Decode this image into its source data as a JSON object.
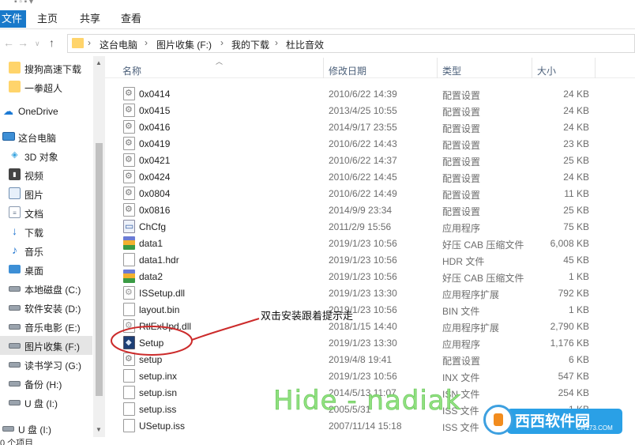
{
  "ribbon": {
    "file_tab": "文件",
    "home_tab": "主页",
    "share_tab": "共享",
    "view_tab": "查看"
  },
  "address": {
    "crumbs": [
      "这台电脑",
      "图片收集 (F:)",
      "我的下载",
      "杜比音效"
    ],
    "separator": "›"
  },
  "nav_pane": {
    "items": [
      {
        "label": "搜狗高速下载",
        "icon": "folder-icon"
      },
      {
        "label": "一拳超人",
        "icon": "folder-icon"
      },
      {
        "label": "OneDrive",
        "icon": "cloud-icon"
      },
      {
        "label": "这台电脑",
        "icon": "computer-icon"
      },
      {
        "label": "3D 对象",
        "icon": "3d-objects-icon"
      },
      {
        "label": "视频",
        "icon": "video-icon"
      },
      {
        "label": "图片",
        "icon": "pictures-icon"
      },
      {
        "label": "文档",
        "icon": "documents-icon"
      },
      {
        "label": "下载",
        "icon": "download-icon"
      },
      {
        "label": "音乐",
        "icon": "music-icon"
      },
      {
        "label": "桌面",
        "icon": "desktop-icon"
      },
      {
        "label": "本地磁盘 (C:)",
        "icon": "drive-icon"
      },
      {
        "label": "软件安装 (D:)",
        "icon": "drive-icon"
      },
      {
        "label": "音乐电影 (E:)",
        "icon": "drive-icon"
      },
      {
        "label": "图片收集 (F:)",
        "icon": "drive-icon"
      },
      {
        "label": "读书学习 (G:)",
        "icon": "drive-icon"
      },
      {
        "label": "备份 (H:)",
        "icon": "drive-icon"
      },
      {
        "label": "U 盘 (I:)",
        "icon": "drive-icon"
      },
      {
        "label": "U 盘 (I:)",
        "icon": "drive-icon"
      }
    ],
    "status": "0 个项目"
  },
  "file_list": {
    "columns": {
      "name": "名称",
      "date": "修改日期",
      "type": "类型",
      "size": "大小"
    },
    "rows": [
      {
        "name": "0x0414",
        "date": "2010/6/22 14:39",
        "type": "配置设置",
        "size": "24 KB",
        "icon": "config-file-icon"
      },
      {
        "name": "0x0415",
        "date": "2013/4/25 10:55",
        "type": "配置设置",
        "size": "24 KB",
        "icon": "config-file-icon"
      },
      {
        "name": "0x0416",
        "date": "2014/9/17 23:55",
        "type": "配置设置",
        "size": "24 KB",
        "icon": "config-file-icon"
      },
      {
        "name": "0x0419",
        "date": "2010/6/22 14:43",
        "type": "配置设置",
        "size": "23 KB",
        "icon": "config-file-icon"
      },
      {
        "name": "0x0421",
        "date": "2010/6/22 14:37",
        "type": "配置设置",
        "size": "25 KB",
        "icon": "config-file-icon"
      },
      {
        "name": "0x0424",
        "date": "2010/6/22 14:45",
        "type": "配置设置",
        "size": "24 KB",
        "icon": "config-file-icon"
      },
      {
        "name": "0x0804",
        "date": "2010/6/22 14:49",
        "type": "配置设置",
        "size": "11 KB",
        "icon": "config-file-icon"
      },
      {
        "name": "0x0816",
        "date": "2014/9/9 23:34",
        "type": "配置设置",
        "size": "25 KB",
        "icon": "config-file-icon"
      },
      {
        "name": "ChCfg",
        "date": "2011/2/9 15:56",
        "type": "应用程序",
        "size": "75 KB",
        "icon": "application-icon"
      },
      {
        "name": "data1",
        "date": "2019/1/23 10:56",
        "type": "好压 CAB 压缩文件",
        "size": "6,008 KB",
        "icon": "cab-archive-icon"
      },
      {
        "name": "data1.hdr",
        "date": "2019/1/23 10:56",
        "type": "HDR 文件",
        "size": "45 KB",
        "icon": "generic-file-icon"
      },
      {
        "name": "data2",
        "date": "2019/1/23 10:56",
        "type": "好压 CAB 压缩文件",
        "size": "1 KB",
        "icon": "cab-archive-icon"
      },
      {
        "name": "ISSetup.dll",
        "date": "2019/1/23 13:30",
        "type": "应用程序扩展",
        "size": "792 KB",
        "icon": "dll-file-icon"
      },
      {
        "name": "layout.bin",
        "date": "2019/1/23 10:56",
        "type": "BIN 文件",
        "size": "1 KB",
        "icon": "generic-file-icon"
      },
      {
        "name": "RtlExUpd.dll",
        "date": "2018/1/15 14:40",
        "type": "应用程序扩展",
        "size": "2,790 KB",
        "icon": "dll-file-icon"
      },
      {
        "name": "Setup",
        "date": "2019/1/23 13:30",
        "type": "应用程序",
        "size": "1,176 KB",
        "icon": "setup-exe-icon"
      },
      {
        "name": "setup",
        "date": "2019/4/8 19:41",
        "type": "配置设置",
        "size": "6 KB",
        "icon": "config-file-icon"
      },
      {
        "name": "setup.inx",
        "date": "2019/1/23 10:56",
        "type": "INX 文件",
        "size": "547 KB",
        "icon": "generic-file-icon"
      },
      {
        "name": "setup.isn",
        "date": "2014/5/13 11:07",
        "type": "ISN 文件",
        "size": "254 KB",
        "icon": "generic-file-icon"
      },
      {
        "name": "setup.iss",
        "date": "2005/5/31",
        "type": "ISS 文件",
        "size": "1 KB",
        "icon": "generic-file-icon"
      },
      {
        "name": "USetup.iss",
        "date": "2007/11/14 15:18",
        "type": "ISS 文件",
        "size": "",
        "icon": "generic-file-icon"
      }
    ]
  },
  "annotation": {
    "text": "双击安装跟着提示走",
    "color": "#cc2b2b"
  },
  "watermark": {
    "text": "Hide - nadiak"
  },
  "logo": {
    "brand": "西西软件园",
    "site": "CR173.COM"
  },
  "colors": {
    "file_tab_bg": "#1979ca",
    "selected_nav_bg": "#e5e5e5",
    "header_text": "#4c607a"
  }
}
